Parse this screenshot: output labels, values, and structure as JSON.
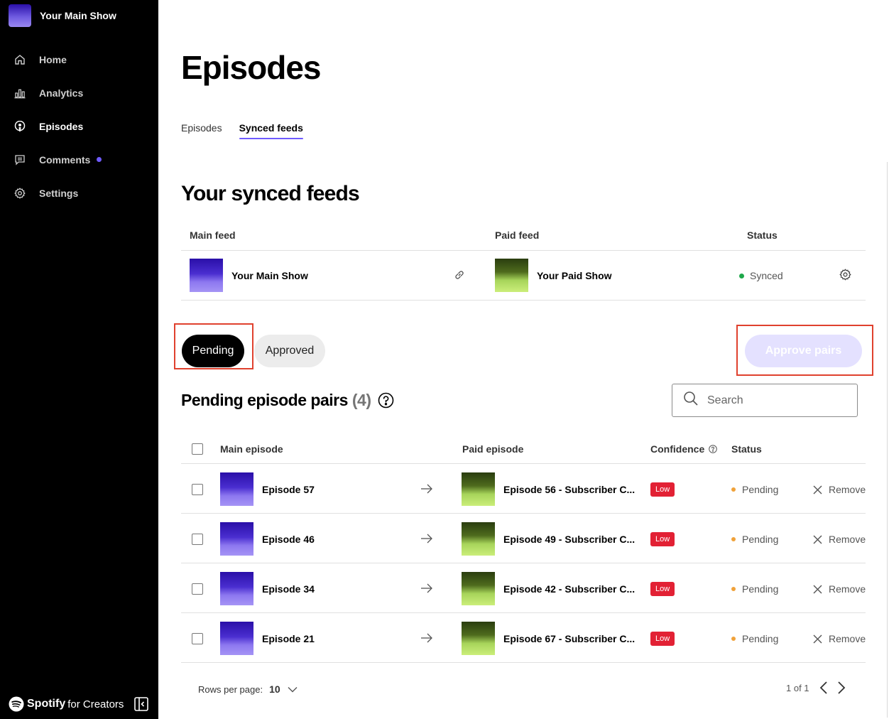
{
  "sidebar": {
    "show_name": "Your Main Show",
    "items": [
      {
        "label": "Home",
        "icon": "home-icon"
      },
      {
        "label": "Analytics",
        "icon": "analytics-icon"
      },
      {
        "label": "Episodes",
        "icon": "episodes-icon",
        "active": true
      },
      {
        "label": "Comments",
        "icon": "comments-icon",
        "has_dot": true
      },
      {
        "label": "Settings",
        "icon": "gear-icon"
      }
    ],
    "brand_spotify": "Spotify",
    "brand_for": "for Creators"
  },
  "page": {
    "title": "Episodes",
    "tabs": [
      {
        "label": "Episodes",
        "active": false
      },
      {
        "label": "Synced feeds",
        "active": true
      }
    ]
  },
  "synced_feeds": {
    "title": "Your synced feeds",
    "headers": {
      "main": "Main feed",
      "paid": "Paid feed",
      "status": "Status"
    },
    "row": {
      "main_name": "Your Main Show",
      "paid_name": "Your Paid Show",
      "status": "Synced"
    }
  },
  "filters": {
    "pending": "Pending",
    "approved": "Approved",
    "approve_pairs": "Approve pairs"
  },
  "pairs": {
    "title": "Pending episode pairs",
    "count": "(4)",
    "search_placeholder": "Search",
    "headers": {
      "main": "Main episode",
      "paid": "Paid episode",
      "confidence": "Confidence",
      "status": "Status"
    },
    "rows": [
      {
        "main": "Episode 57",
        "paid": "Episode 56 - Subscriber C...",
        "confidence": "Low",
        "status": "Pending",
        "remove": "Remove"
      },
      {
        "main": "Episode 46",
        "paid": "Episode 49 - Subscriber C...",
        "confidence": "Low",
        "status": "Pending",
        "remove": "Remove"
      },
      {
        "main": "Episode 34",
        "paid": "Episode 42 - Subscriber C...",
        "confidence": "Low",
        "status": "Pending",
        "remove": "Remove"
      },
      {
        "main": "Episode 21",
        "paid": "Episode 67 - Subscriber C...",
        "confidence": "Low",
        "status": "Pending",
        "remove": "Remove"
      }
    ]
  },
  "footer": {
    "rows_per_page_label": "Rows per page:",
    "rows_per_page_value": "10",
    "page_info": "1 of 1"
  },
  "colors": {
    "accent": "#6f5bff",
    "low_badge": "#e22134",
    "synced": "#1ea84a",
    "pending": "#f0a23a",
    "highlight": "#e0412e"
  }
}
